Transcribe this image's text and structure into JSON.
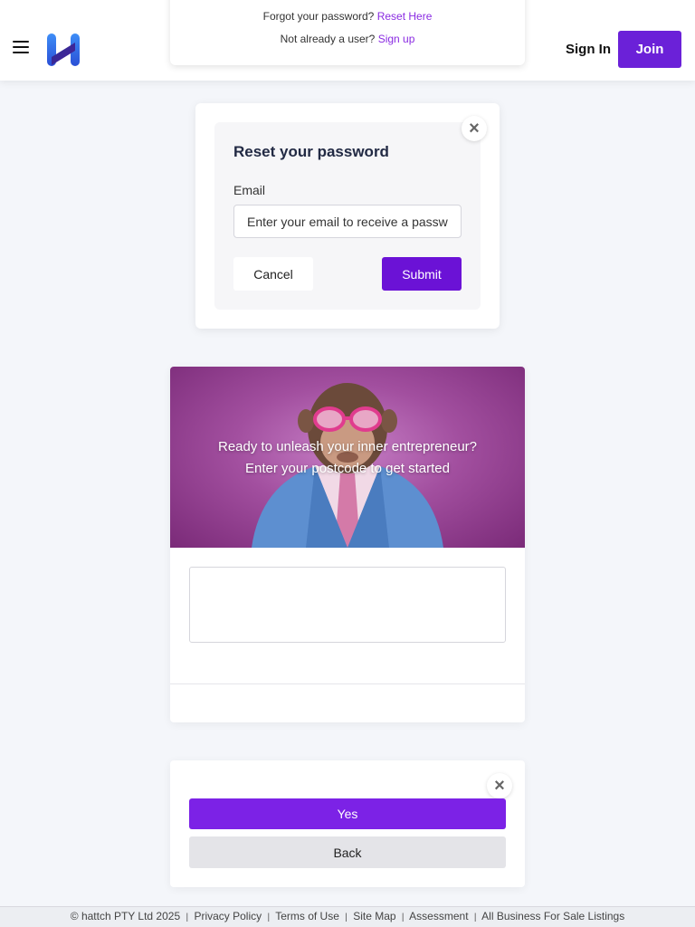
{
  "header": {
    "logo_icon": "hattch-h-logo-icon",
    "menu_icon": "hamburger-menu-icon",
    "signin_label": "Sign In",
    "join_label": "Join",
    "accent_color": "#6b21d8"
  },
  "login_card": {
    "forgot_text": "Forgot your password?",
    "reset_link": "Reset Here",
    "not_user_text": "Not already a user?",
    "signup_link": "Sign up"
  },
  "reset_modal": {
    "title": "Reset your password",
    "email_label": "Email",
    "email_placeholder": "Enter your email to receive a password reset link",
    "email_value": "",
    "cancel_label": "Cancel",
    "submit_label": "Submit",
    "close_icon": "close-icon"
  },
  "postcode_card": {
    "hero_line1": "Ready to unleash your inner entrepreneur?",
    "hero_line2": "Enter your postcode to get started",
    "hero_image": "monkey-in-suit-with-pink-glasses",
    "postcode_value": ""
  },
  "confirm_card": {
    "yes_label": "Yes",
    "back_label": "Back",
    "close_icon": "close-icon"
  },
  "footer": {
    "copyright": "© hattch PTY Ltd 2025",
    "separator": "|",
    "links": [
      "Privacy Policy",
      "Terms of Use",
      "Site Map",
      "Assessment",
      "All Business For Sale Listings"
    ]
  }
}
